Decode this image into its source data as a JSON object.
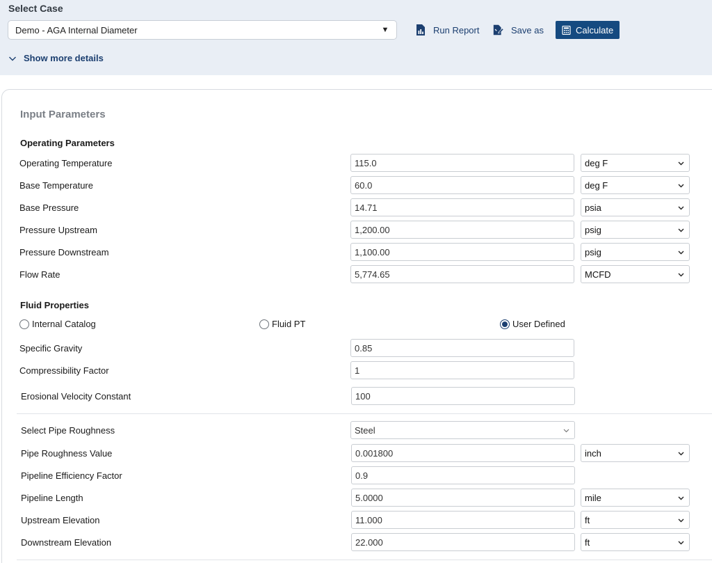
{
  "header": {
    "select_case_label": "Select Case",
    "case_value": "Demo - AGA Internal Diameter",
    "run_report": "Run Report",
    "save_as": "Save as",
    "calculate": "Calculate",
    "show_more": "Show more details"
  },
  "input": {
    "title": "Input Parameters",
    "operating_section": "Operating Parameters",
    "operating": [
      {
        "label": "Operating Temperature",
        "value": "115.0",
        "unit": "deg F"
      },
      {
        "label": "Base Temperature",
        "value": "60.0",
        "unit": "deg F"
      },
      {
        "label": "Base Pressure",
        "value": "14.71",
        "unit": "psia"
      },
      {
        "label": "Pressure Upstream",
        "value": "1,200.00",
        "unit": "psig"
      },
      {
        "label": "Pressure Downstream",
        "value": "1,100.00",
        "unit": "psig"
      },
      {
        "label": "Flow Rate",
        "value": "5,774.65",
        "unit": "MCFD"
      }
    ],
    "fluid_section": "Fluid Properties",
    "fluid_options": [
      {
        "label": "Internal Catalog",
        "selected": false
      },
      {
        "label": "Fluid PT",
        "selected": false
      },
      {
        "label": "User Defined",
        "selected": true
      }
    ],
    "fluid": [
      {
        "label": "Specific Gravity",
        "value": "0.85"
      },
      {
        "label": "Compressibility Factor",
        "value": "1"
      },
      {
        "label": "Erosional Velocity Constant",
        "value": "100"
      }
    ],
    "pipe": {
      "roughness_select_label": "Select Pipe Roughness",
      "roughness_select_value": "Steel",
      "rows": [
        {
          "label": "Pipe Roughness Value",
          "value": "0.001800",
          "unit": "inch"
        },
        {
          "label": "Pipeline Efficiency Factor",
          "value": "0.9",
          "unit": null
        },
        {
          "label": "Pipeline Length",
          "value": "5.0000",
          "unit": "mile"
        },
        {
          "label": "Upstream Elevation",
          "value": "11.000",
          "unit": "ft"
        },
        {
          "label": "Downstream Elevation",
          "value": "22.000",
          "unit": "ft"
        }
      ]
    }
  },
  "colors": {
    "accent": "#154a80",
    "link": "#1c3f70",
    "header_bg": "#e9eef5"
  },
  "icons": {
    "run_report": "report-chart-icon",
    "save_as": "save-edit-icon",
    "calculate": "calculator-icon",
    "show_more": "chevron-down-icon",
    "dropdown": "chevron-down-icon"
  }
}
